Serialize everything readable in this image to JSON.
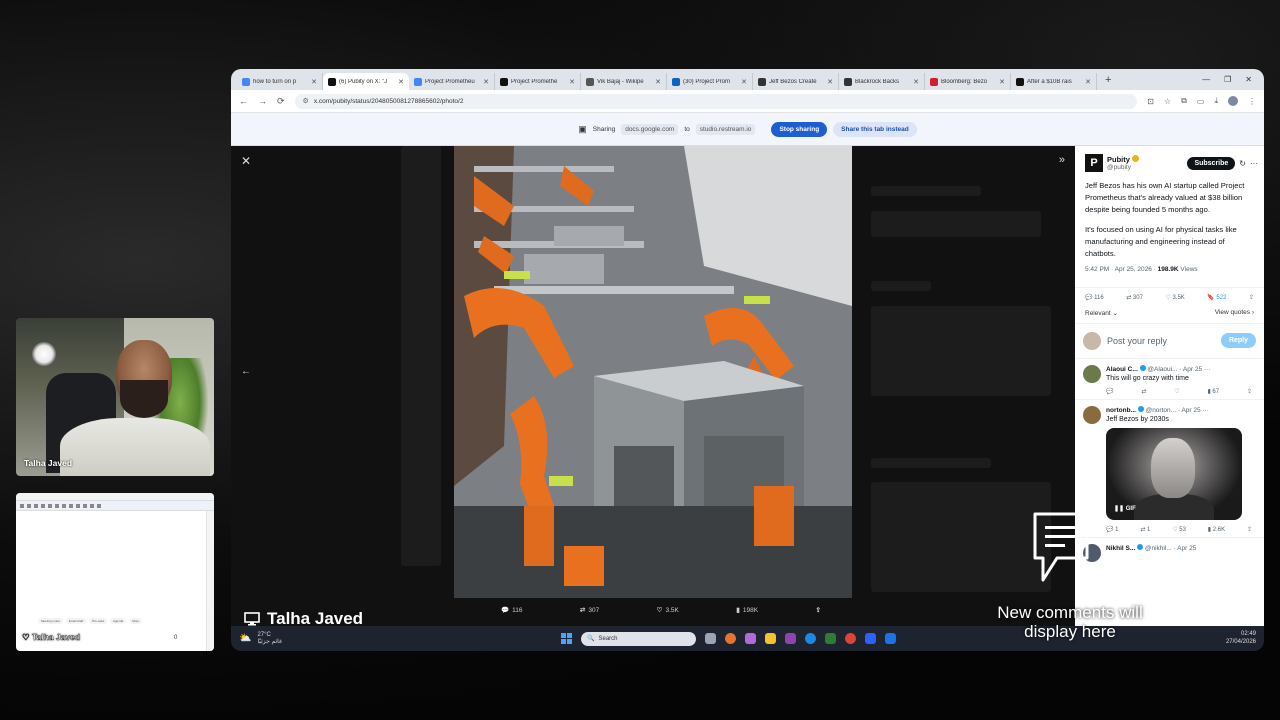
{
  "browser": {
    "tabs": [
      {
        "label": "how to turn on p",
        "color": "#4285f4",
        "active": false
      },
      {
        "label": "(6) Pubity on X: \"J",
        "color": "#111111",
        "active": true
      },
      {
        "label": "Project Prometheu",
        "color": "#4285f4",
        "active": false
      },
      {
        "label": "Project Promethe",
        "color": "#111111",
        "active": false
      },
      {
        "label": "Vik Bajaj - Wikipe",
        "color": "#555555",
        "active": false
      },
      {
        "label": "(30) Project Prom",
        "color": "#0a66c2",
        "active": false
      },
      {
        "label": "Jeff Bezos Create",
        "color": "#333333",
        "active": false
      },
      {
        "label": "Blackrock Backs",
        "color": "#333333",
        "active": false
      },
      {
        "label": "Bloomberg: Bezo",
        "color": "#d21f2c",
        "active": false
      },
      {
        "label": "After a $10B rais",
        "color": "#111111",
        "active": false
      }
    ],
    "url": "x.com/pubity/status/2048050081278865602/photo/2",
    "sharing": {
      "label": "Sharing",
      "from": "docs.google.com",
      "to_label": "to",
      "to": "studio.restream.io",
      "stop_button": "Stop sharing",
      "share_tab_button": "Share this tab instead"
    }
  },
  "viewer": {
    "actions": {
      "replies": "116",
      "reposts": "307",
      "likes": "3.5K",
      "views": "198K"
    }
  },
  "tweet": {
    "author_name": "Pubity",
    "author_handle": "@pubity",
    "subscribe_label": "Subscribe",
    "paragraph1": "Jeff Bezos has his own AI startup called Project Prometheus that's already valued at $38 billion despite being founded 5 months ago.",
    "paragraph2": "It's focused on using AI for physical tasks like manufacturing and engineering instead of chatbots.",
    "time": "5:42 PM · Apr 25, 2026 ·",
    "views_count": "198.9K",
    "views_label": "Views",
    "replies": "116",
    "reposts": "307",
    "likes": "3.5K",
    "bookmarks": "522",
    "sort_label": "Relevant",
    "view_quotes": "View quotes",
    "reply_placeholder": "Post your reply",
    "reply_button": "Reply",
    "comments": [
      {
        "name": "Alaoui C...",
        "handle": "@Alaoui...",
        "date": "· Apr 25",
        "text": "This will go crazy with time",
        "views": "67",
        "av": "#6b7a4c"
      },
      {
        "name": "nortonb...",
        "handle": "@norton...",
        "date": "· Apr 25",
        "text": "Jeff Bezos by 2030s",
        "replies": "1",
        "reposts": "1",
        "likes": "53",
        "views": "2.6K",
        "gif": "GIF",
        "av": "#8a6a3f"
      },
      {
        "name": "Nikhil S...",
        "handle": "@nikhil...",
        "date": "· Apr 25",
        "av": "#4f5b6b"
      }
    ]
  },
  "taskbar": {
    "temp": "27°C",
    "weather_sub": "غائم جزئيًا",
    "search_placeholder": "Search",
    "time": "02:49",
    "date": "27/04/2026"
  },
  "webcam": {
    "name": "Talha Javed"
  },
  "doc_thumb": {
    "name": "Talha Javed",
    "chips": [
      "Meeting notes",
      "Email draft",
      "Pre-read",
      "Agenda",
      "More"
    ],
    "count": "0"
  },
  "overlay": {
    "presenter_name": "Talha Javed",
    "comments_message": "New comments will display here"
  }
}
